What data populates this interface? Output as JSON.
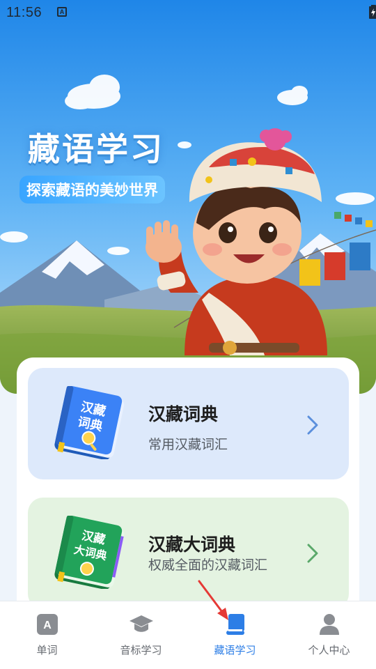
{
  "status_bar": {
    "time": "11:56",
    "app_icon_letter": "A"
  },
  "hero": {
    "title": "藏语学习",
    "subtitle": "探索藏语的美妙世界"
  },
  "cards": [
    {
      "title": "汉藏词典",
      "subtitle": "常用汉藏词汇",
      "book_text_line1": "汉藏",
      "book_text_line2": "词典",
      "accent": "#3b82f6"
    },
    {
      "title": "汉藏大词典",
      "subtitle": "权威全面的汉藏词汇",
      "book_text_line1": "汉藏",
      "book_text_line2": "大词典",
      "accent": "#22a35a"
    }
  ],
  "bottom_nav": {
    "active_index": 2,
    "items": [
      {
        "label": "单词",
        "icon": "letter-a-icon",
        "glyph": "A"
      },
      {
        "label": "音标学习",
        "icon": "graduation-cap-icon"
      },
      {
        "label": "藏语学习",
        "icon": "book-icon"
      },
      {
        "label": "个人中心",
        "icon": "user-icon"
      }
    ]
  },
  "colors": {
    "active": "#2d7ee6",
    "inactive": "#666a70",
    "card1_bg": "#dde9fb",
    "card2_bg": "#e4f3e1"
  }
}
